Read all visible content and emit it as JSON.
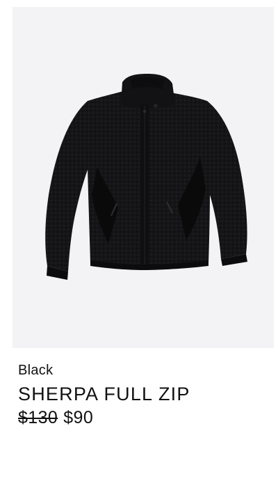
{
  "product": {
    "image_alt": "Black sherpa full zip jacket",
    "color": "Black",
    "title": "SHERPA FULL ZIP",
    "price_original": "$130",
    "price_sale": "$90"
  },
  "colors": {
    "background": "#ffffff",
    "image_background": "#f3f3f5",
    "jacket": "#141416",
    "text": "#111111"
  }
}
